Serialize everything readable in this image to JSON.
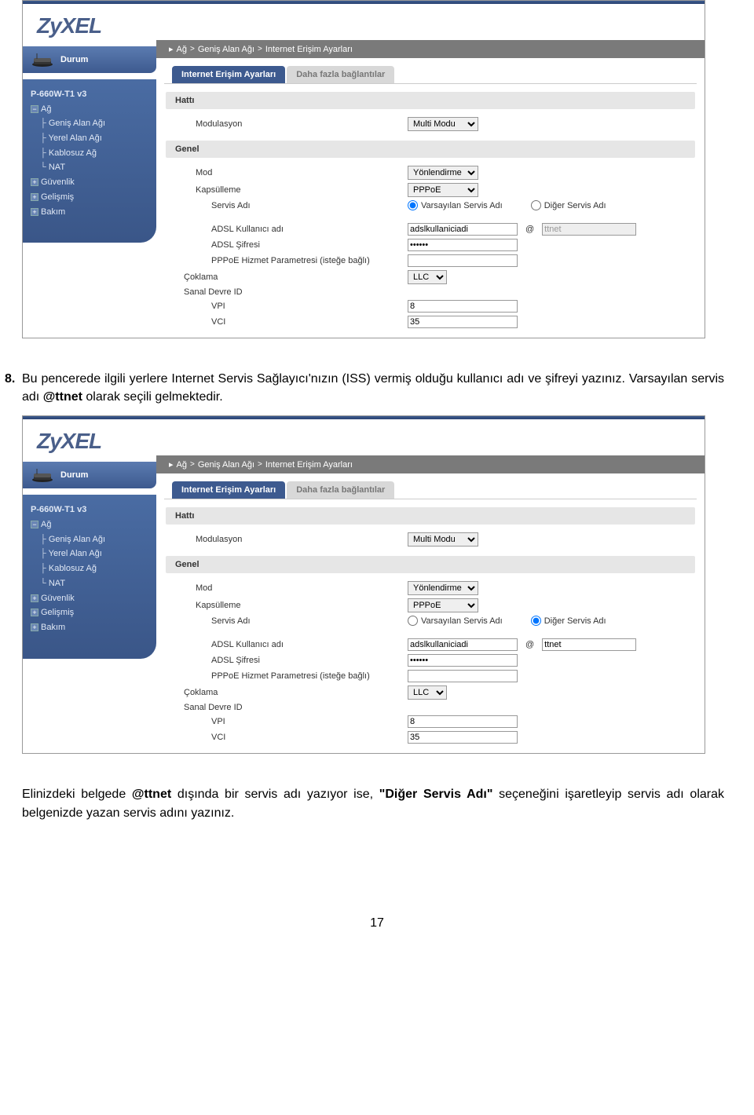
{
  "logo": "ZyXEL",
  "durum_label": "Durum",
  "breadcrumb": {
    "i1": "Ağ",
    "i2": "Geniş Alan Ağı",
    "i3": "Internet Erişim Ayarları",
    "sep": ">"
  },
  "tabs": {
    "active": "Internet Erişim Ayarları",
    "inactive": "Daha fazla bağlantılar"
  },
  "sections": {
    "hatti": "Hattı",
    "genel": "Genel"
  },
  "nav": {
    "model": "P-660W-T1 v3",
    "ag": "Ağ",
    "genis": "Geniş Alan Ağı",
    "yerel": "Yerel Alan Ağı",
    "kablosuz": "Kablosuz Ağ",
    "nat": "NAT",
    "guvenlik": "Güvenlik",
    "gelismis": "Gelişmiş",
    "bakim": "Bakım"
  },
  "form": {
    "modulasyon_label": "Modulasyon",
    "modulasyon_value": "Multi Modu",
    "mod_label": "Mod",
    "mod_value": "Yönlendirme",
    "kapsulleme_label": "Kapsülleme",
    "kapsulleme_value": "PPPoE",
    "servis_adi_label": "Servis Adı",
    "varsayilan_label": "Varsayılan Servis Adı",
    "diger_label": "Diğer Servis Adı",
    "adsl_user_label": "ADSL Kullanıcı adı",
    "adsl_user_value": "adslkullaniciadi",
    "adsl_pass_label": "ADSL Şifresi",
    "adsl_pass_value": "••••••",
    "pppoe_label": "PPPoE Hizmet Parametresi (isteğe bağlı)",
    "coklama_label": "Çoklama",
    "coklama_value": "LLC",
    "sanal_label": "Sanal Devre ID",
    "vpi_label": "VPI",
    "vpi_value": "8",
    "vci_label": "VCI",
    "vci_value": "35",
    "at": "@",
    "domain_value": "ttnet"
  },
  "instruction1": {
    "num": "8.",
    "t1": "Bu pencerede ilgili yerlere Internet Servis Sağlayıcı'nızın (ISS) vermiş olduğu kullanıcı adı ve şifreyi yazınız. Varsayılan servis adı ",
    "b1": "@ttnet",
    "t2": " olarak seçili gelmektedir."
  },
  "instruction2": {
    "t1": "Elinizdeki belgede ",
    "b1": "@ttnet",
    "t2": " dışında bir servis adı yazıyor ise, ",
    "b2": "\"Diğer Servis Adı\"",
    "t3": " seçeneğini işaretleyip servis adı olarak belgenizde yazan servis adını yazınız."
  },
  "page_number": "17"
}
